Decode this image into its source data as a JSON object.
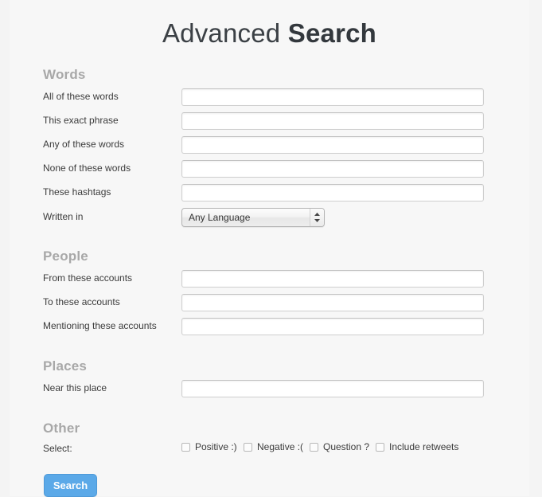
{
  "page": {
    "title_light": "Advanced",
    "title_bold": "Search",
    "background_color": "#f4f4f4",
    "panel_color": "#f7f7f7",
    "accent_color": "#5ba9e8"
  },
  "sections": {
    "words": {
      "heading": "Words",
      "fields": [
        {
          "label": "All of these words",
          "value": "",
          "placeholder": ""
        },
        {
          "label": "This exact phrase",
          "value": "",
          "placeholder": ""
        },
        {
          "label": "Any of these words",
          "value": "",
          "placeholder": ""
        },
        {
          "label": "None of these words",
          "value": "",
          "placeholder": ""
        },
        {
          "label": "These hashtags",
          "value": "",
          "placeholder": ""
        }
      ],
      "language": {
        "label": "Written in",
        "selected": "Any Language",
        "icon": "updown-stepper-icon"
      }
    },
    "people": {
      "heading": "People",
      "fields": [
        {
          "label": "From these accounts",
          "value": "",
          "placeholder": ""
        },
        {
          "label": "To these accounts",
          "value": "",
          "placeholder": ""
        },
        {
          "label": "Mentioning these accounts",
          "value": "",
          "placeholder": ""
        }
      ]
    },
    "places": {
      "heading": "Places",
      "fields": [
        {
          "label": "Near this place",
          "value": "",
          "placeholder": ""
        }
      ]
    },
    "other": {
      "heading": "Other",
      "select_label": "Select:",
      "checkboxes": [
        {
          "label": "Positive :)",
          "checked": false
        },
        {
          "label": "Negative :(",
          "checked": false
        },
        {
          "label": "Question ?",
          "checked": false
        },
        {
          "label": "Include retweets",
          "checked": false
        }
      ]
    }
  },
  "submit": {
    "label": "Search"
  }
}
